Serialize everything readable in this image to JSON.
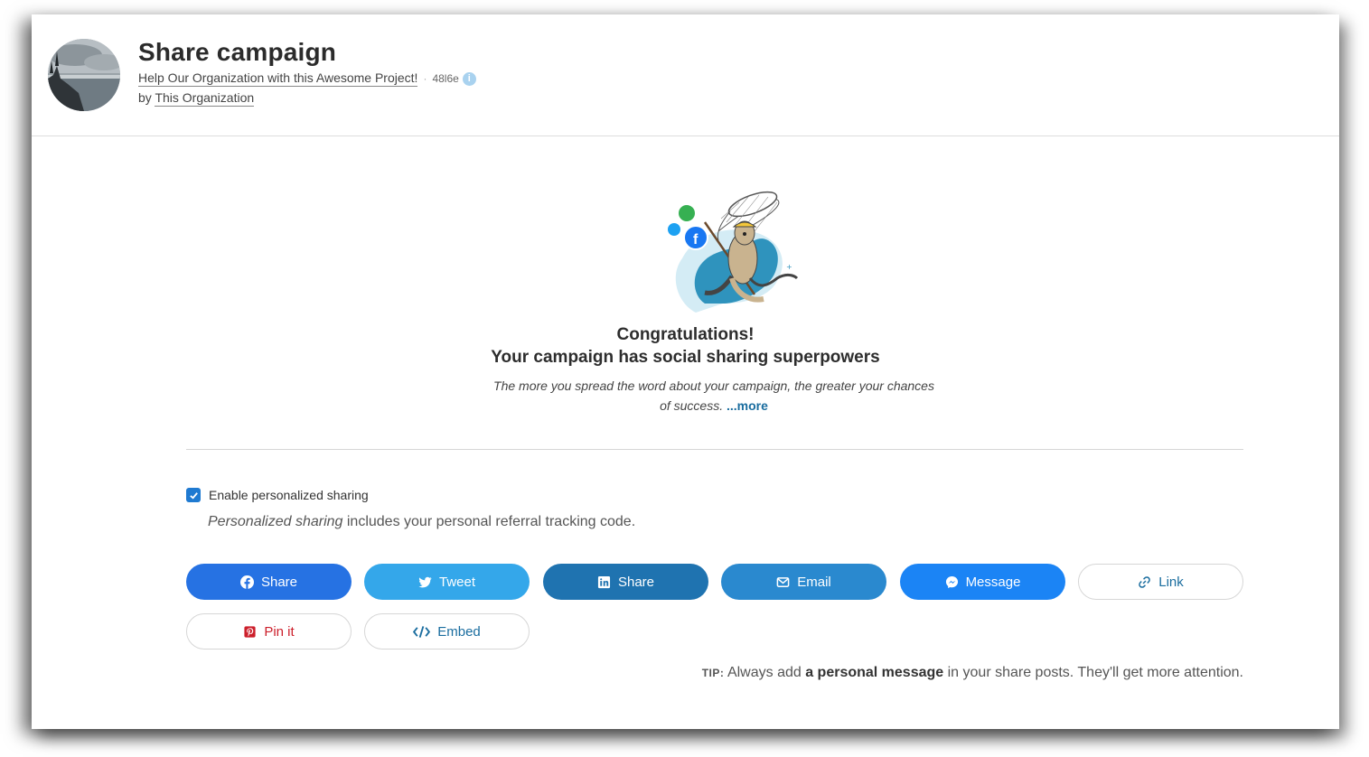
{
  "header": {
    "title": "Share campaign",
    "project_name": "Help Our Organization with this Awesome Project!",
    "separator": "·",
    "code": "48l6e",
    "info_icon": "i",
    "by_prefix": "by ",
    "organization": "This Organization"
  },
  "hero": {
    "congrats_line1": "Congratulations!",
    "congrats_line2": "Your campaign has social sharing superpowers",
    "description": "The more you spread the word about your campaign, the greater your chances of success. ",
    "more_link": "...more"
  },
  "personalized": {
    "checkbox_label": "Enable personalized sharing",
    "checked": true,
    "note_em": "Personalized sharing",
    "note_rest": " includes your personal referral tracking code."
  },
  "buttons": [
    {
      "label": "Share",
      "icon": "facebook-icon",
      "color": "#2672e3"
    },
    {
      "label": "Tweet",
      "icon": "twitter-icon",
      "color": "#34a7ea"
    },
    {
      "label": "Share",
      "icon": "linkedin-icon",
      "color": "#1f73b0"
    },
    {
      "label": "Email",
      "icon": "email-icon",
      "color": "#2a89cf"
    },
    {
      "label": "Message",
      "icon": "messenger-icon",
      "color": "#1b84f5"
    },
    {
      "label": "Link",
      "icon": "link-icon",
      "color": "#1a6d9f"
    },
    {
      "label": "Pin it",
      "icon": "pinterest-icon",
      "color": "#cc1f2b"
    },
    {
      "label": "Embed",
      "icon": "code-icon",
      "color": "#1a6d9f"
    }
  ],
  "tip": {
    "label": "TIP:",
    "text_before": " Always add ",
    "bold": "a personal message",
    "text_after": " in your share posts. They'll get more attention."
  }
}
